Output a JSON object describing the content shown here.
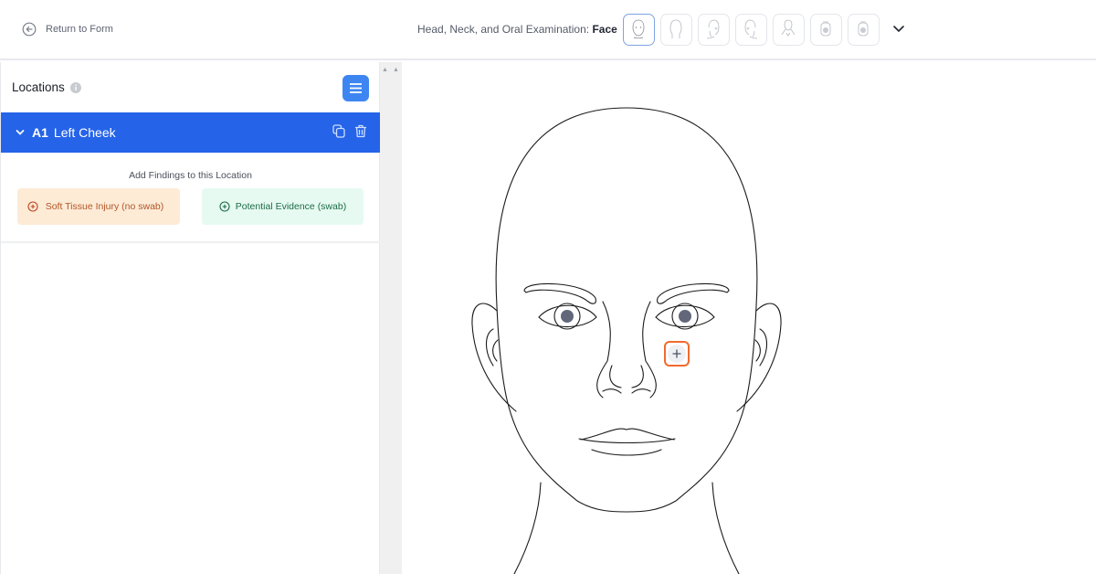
{
  "header": {
    "back_label": "Return to Form",
    "exam_prefix": "Head, Neck, and Oral Examination:",
    "exam_view": "Face",
    "views": [
      {
        "name": "face-front",
        "active": true
      },
      {
        "name": "head-back",
        "active": false
      },
      {
        "name": "head-right",
        "active": false
      },
      {
        "name": "head-left",
        "active": false
      },
      {
        "name": "neck-front",
        "active": false
      },
      {
        "name": "mouth-upper",
        "active": false
      },
      {
        "name": "mouth-lower",
        "active": false
      }
    ]
  },
  "sidebar": {
    "title": "Locations",
    "location": {
      "code": "A1",
      "name": "Left Cheek"
    },
    "add_findings_label": "Add Findings to this Location",
    "findings": [
      {
        "label": "Soft Tissue Injury (no swab)",
        "color": "#b25528",
        "bg": "#fdebd6"
      },
      {
        "label": "Potential Evidence (swab)",
        "color": "#1d6b47",
        "bg": "#e6faf1"
      }
    ]
  },
  "canvas": {
    "marker_symbol": "+",
    "marker_color": "#f26a2e"
  },
  "colors": {
    "primary": "#2563e8",
    "accent": "#3d86f2"
  }
}
